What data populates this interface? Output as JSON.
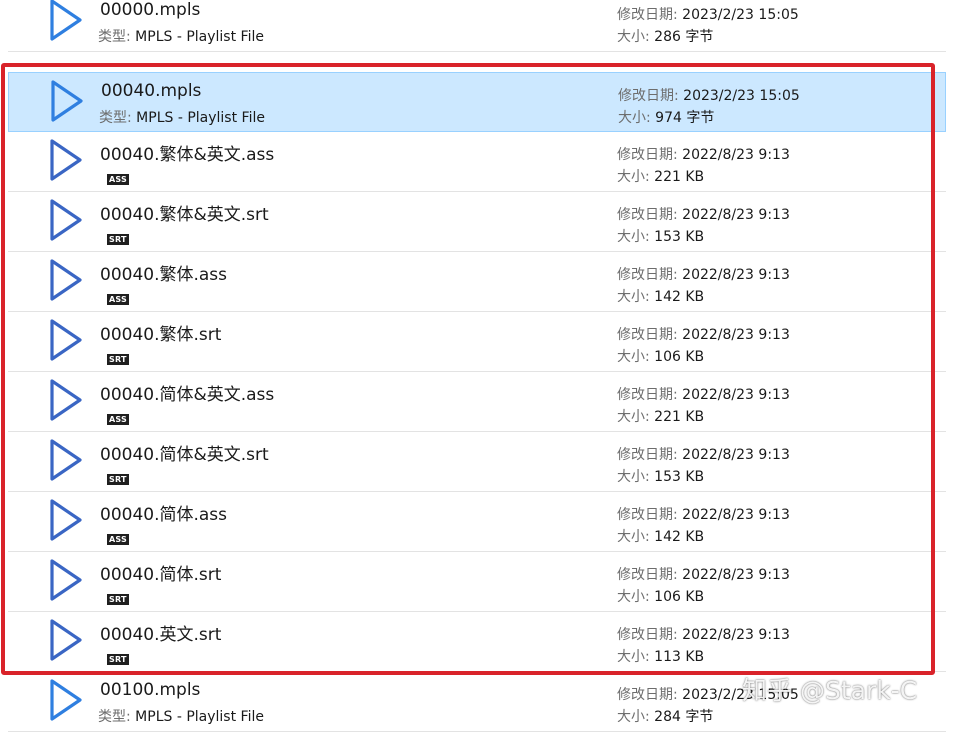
{
  "labels": {
    "type": "类型:",
    "modified": "修改日期:",
    "size": "大小:"
  },
  "colors": {
    "selection_bg": "#cce8ff",
    "selection_border": "#99d1ff",
    "annotation_box": "#d9232a",
    "play_icon_blue": "#2f7fe0",
    "subtitle_icon_blue": "#3a66c4"
  },
  "files": [
    {
      "name": "00000.mpls",
      "type": "MPLS - Playlist File",
      "modified": "2023/2/23 15:05",
      "size": "286 字节",
      "icon": "play-icon",
      "badge": "",
      "selected": false
    },
    {
      "name": "00040.mpls",
      "type": "MPLS - Playlist File",
      "modified": "2023/2/23 15:05",
      "size": "974 字节",
      "icon": "play-icon",
      "badge": "",
      "selected": true
    },
    {
      "name": "00040.繁体&英文.ass",
      "type": "",
      "modified": "2022/8/23 9:13",
      "size": "221 KB",
      "icon": "subtitle-file-icon",
      "badge": "ASS",
      "selected": false
    },
    {
      "name": "00040.繁体&英文.srt",
      "type": "",
      "modified": "2022/8/23 9:13",
      "size": "153 KB",
      "icon": "subtitle-file-icon",
      "badge": "SRT",
      "selected": false
    },
    {
      "name": "00040.繁体.ass",
      "type": "",
      "modified": "2022/8/23 9:13",
      "size": "142 KB",
      "icon": "subtitle-file-icon",
      "badge": "ASS",
      "selected": false
    },
    {
      "name": "00040.繁体.srt",
      "type": "",
      "modified": "2022/8/23 9:13",
      "size": "106 KB",
      "icon": "subtitle-file-icon",
      "badge": "SRT",
      "selected": false
    },
    {
      "name": "00040.简体&英文.ass",
      "type": "",
      "modified": "2022/8/23 9:13",
      "size": "221 KB",
      "icon": "subtitle-file-icon",
      "badge": "ASS",
      "selected": false
    },
    {
      "name": "00040.简体&英文.srt",
      "type": "",
      "modified": "2022/8/23 9:13",
      "size": "153 KB",
      "icon": "subtitle-file-icon",
      "badge": "SRT",
      "selected": false
    },
    {
      "name": "00040.简体.ass",
      "type": "",
      "modified": "2022/8/23 9:13",
      "size": "142 KB",
      "icon": "subtitle-file-icon",
      "badge": "ASS",
      "selected": false
    },
    {
      "name": "00040.简体.srt",
      "type": "",
      "modified": "2022/8/23 9:13",
      "size": "106 KB",
      "icon": "subtitle-file-icon",
      "badge": "SRT",
      "selected": false
    },
    {
      "name": "00040.英文.srt",
      "type": "",
      "modified": "2022/8/23 9:13",
      "size": "113 KB",
      "icon": "subtitle-file-icon",
      "badge": "SRT",
      "selected": false
    },
    {
      "name": "00100.mpls",
      "type": "MPLS - Playlist File",
      "modified": "2023/2/23 15:05",
      "size": "284 字节",
      "icon": "play-icon",
      "badge": "",
      "selected": false
    }
  ],
  "watermark": "知乎 @Stark-C"
}
